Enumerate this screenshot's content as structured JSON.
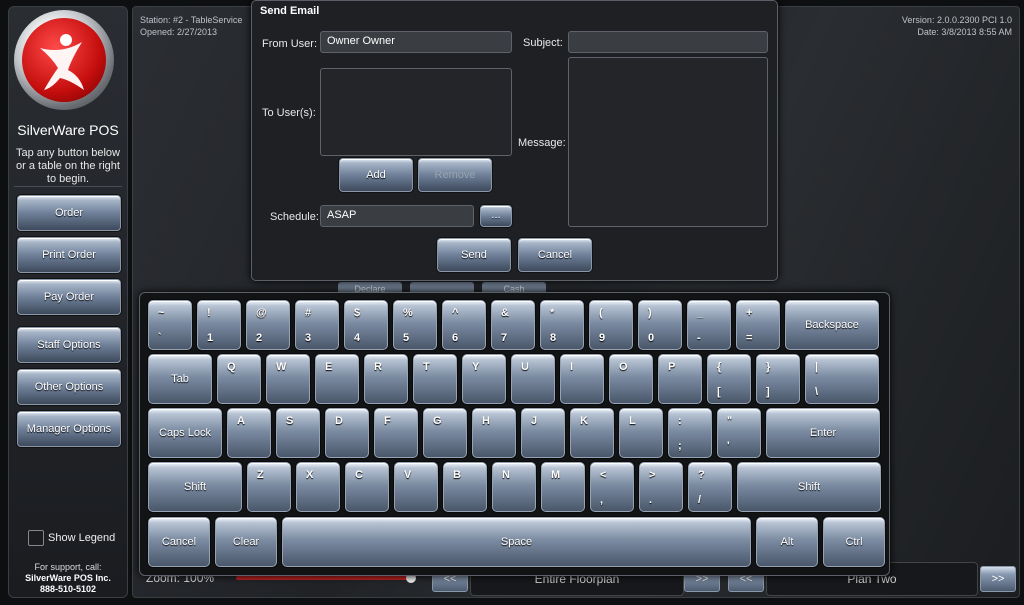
{
  "brand": {
    "name": "SilverWare POS",
    "hint": "Tap any button below or a table on the right to begin."
  },
  "sidebar": {
    "buttons": [
      "Order",
      "Print Order",
      "Pay Order",
      "Staff Options",
      "Other Options",
      "Manager Options"
    ],
    "legend_label": "Show Legend",
    "support_line": "For support, call:",
    "support_company": "SilverWare POS Inc.",
    "support_phone": "888-510-5102"
  },
  "header": {
    "station": "Station: #2 - TableService",
    "opened": "Opened: 2/27/2013",
    "version": "Version: 2.0.0.2300 PCI 1.0",
    "date": "Date: 3/8/2013 8:55 AM"
  },
  "behind": {
    "declare": "Declare",
    "cash": "Cash"
  },
  "bottom_bar": {
    "zoom_label": "Zoom: 100%",
    "prev": "<<",
    "next": ">>",
    "floorplan": "Entire Floorplan",
    "plan": "Plan Two"
  },
  "dialog": {
    "title": "Send Email",
    "from_label": "From User:",
    "from_value": "Owner Owner",
    "to_label": "To User(s):",
    "subject_label": "Subject:",
    "subject_value": "",
    "message_label": "Message:",
    "add": "Add",
    "remove": "Remove",
    "schedule_label": "Schedule:",
    "schedule_value": "ASAP",
    "ellipsis": "...",
    "send": "Send",
    "cancel": "Cancel"
  },
  "keyboard": {
    "rows": [
      [
        {
          "top": "~",
          "bot": "`"
        },
        {
          "top": "!",
          "bot": "1"
        },
        {
          "top": "@",
          "bot": "2"
        },
        {
          "top": "#",
          "bot": "3"
        },
        {
          "top": "$",
          "bot": "4"
        },
        {
          "top": "%",
          "bot": "5"
        },
        {
          "top": "^",
          "bot": "6"
        },
        {
          "top": "&",
          "bot": "7"
        },
        {
          "top": "*",
          "bot": "8"
        },
        {
          "top": "(",
          "bot": "9"
        },
        {
          "top": ")",
          "bot": "0"
        },
        {
          "top": "_",
          "bot": "-"
        },
        {
          "top": "+",
          "bot": "="
        },
        {
          "label": "Backspace"
        }
      ],
      [
        {
          "label": "Tab"
        },
        {
          "top": "Q"
        },
        {
          "top": "W"
        },
        {
          "top": "E"
        },
        {
          "top": "R"
        },
        {
          "top": "T"
        },
        {
          "top": "Y"
        },
        {
          "top": "U"
        },
        {
          "top": "I"
        },
        {
          "top": "O"
        },
        {
          "top": "P"
        },
        {
          "top": "{",
          "bot": "["
        },
        {
          "top": "}",
          "bot": "]"
        },
        {
          "top": "|",
          "bot": "\\"
        }
      ],
      [
        {
          "label": "Caps Lock"
        },
        {
          "top": "A"
        },
        {
          "top": "S"
        },
        {
          "top": "D"
        },
        {
          "top": "F"
        },
        {
          "top": "G"
        },
        {
          "top": "H"
        },
        {
          "top": "J"
        },
        {
          "top": "K"
        },
        {
          "top": "L"
        },
        {
          "top": ":",
          "bot": ";"
        },
        {
          "top": "\"",
          "bot": "'"
        },
        {
          "label": "Enter"
        }
      ],
      [
        {
          "label": "Shift"
        },
        {
          "top": "Z"
        },
        {
          "top": "X"
        },
        {
          "top": "C"
        },
        {
          "top": "V"
        },
        {
          "top": "B"
        },
        {
          "top": "N"
        },
        {
          "top": "M"
        },
        {
          "top": "<",
          "bot": ","
        },
        {
          "top": ">",
          "bot": "."
        },
        {
          "top": "?",
          "bot": "/"
        },
        {
          "label": "Shift"
        }
      ],
      [
        {
          "label": "Cancel"
        },
        {
          "label": "Clear"
        },
        {
          "label": "Space"
        },
        {
          "label": "Alt"
        },
        {
          "label": "Ctrl"
        }
      ]
    ]
  }
}
